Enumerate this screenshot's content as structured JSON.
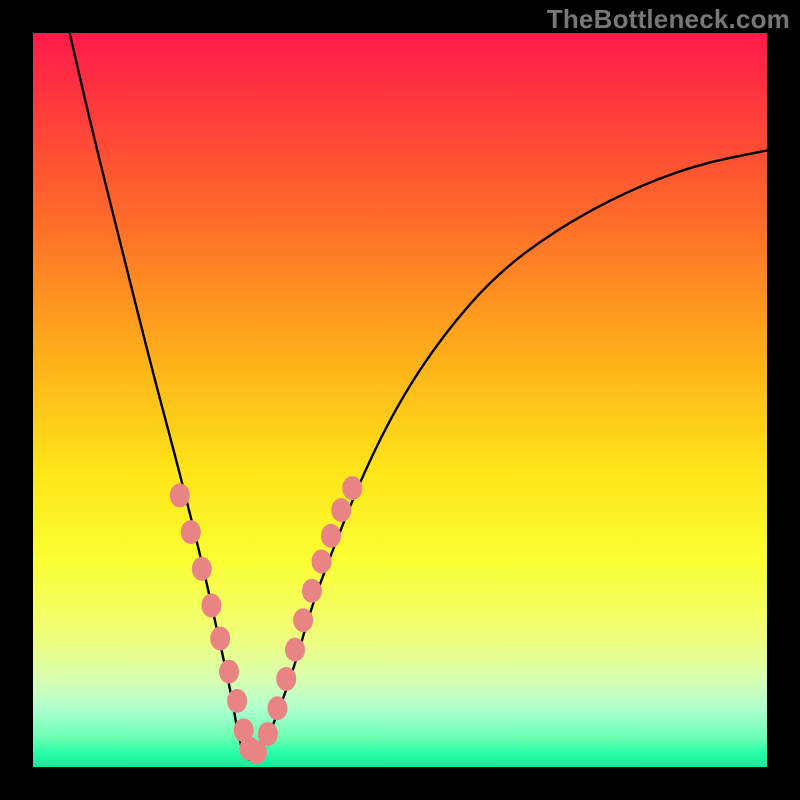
{
  "watermark": "TheBottleneck.com",
  "colors": {
    "frame": "#000000",
    "gradient_top": "#ff1b4b",
    "gradient_bottom": "#16e898",
    "curve_stroke": "#000000",
    "marker_fill": "#e98484",
    "marker_stroke": "#cf6d6d"
  },
  "chart_data": {
    "type": "line",
    "title": "",
    "xlabel": "",
    "ylabel": "",
    "xlim": [
      0,
      100
    ],
    "ylim": [
      0,
      100
    ],
    "note": "Axes are not labeled in the image; x and y are normalized 0-100 to the plot area. Curve is a V-shaped bottleneck curve with minimum near x≈29.",
    "series": [
      {
        "name": "bottleneck-curve",
        "x": [
          5,
          8,
          12,
          16,
          20,
          23,
          25,
          27,
          28,
          29,
          30,
          32,
          34,
          36,
          38,
          41,
          45,
          50,
          56,
          63,
          71,
          80,
          90,
          100
        ],
        "values": [
          100,
          87,
          71,
          55,
          40,
          28,
          19,
          10,
          4,
          1,
          1,
          4,
          9,
          15,
          22,
          30,
          40,
          50,
          59,
          67,
          73,
          78,
          82,
          84
        ]
      }
    ],
    "markers": {
      "name": "dotted-region",
      "note": "Pink dots overlaid along the curve in the lower portion (roughly y < 30 region).",
      "x": [
        20,
        21.5,
        23,
        24.3,
        25.5,
        26.7,
        27.8,
        28.7,
        29.5,
        30.5,
        32,
        33.3,
        34.5,
        35.7,
        36.8,
        38,
        39.3,
        40.6,
        42,
        43.5
      ],
      "values": [
        37,
        32,
        27,
        22,
        17.5,
        13,
        9,
        5,
        2.5,
        2,
        4.5,
        8,
        12,
        16,
        20,
        24,
        28,
        31.5,
        35,
        38
      ]
    }
  }
}
